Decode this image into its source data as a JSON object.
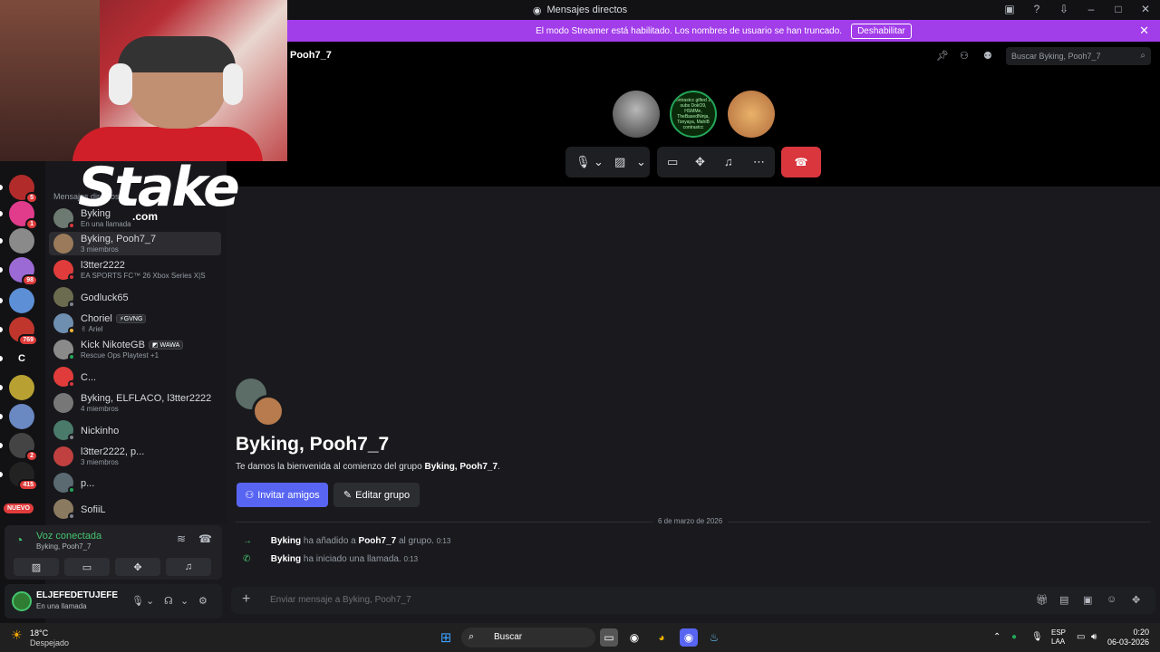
{
  "window": {
    "title": "Mensajes directos"
  },
  "banner": {
    "text": "El modo Streamer está habilitado. Los nombres de usuario se han truncado.",
    "button": "Deshabilitar"
  },
  "servers": [
    {
      "letter": "",
      "badge": "5",
      "color": "#b22b2b"
    },
    {
      "letter": "",
      "badge": "1",
      "color": "#e13b8c"
    },
    {
      "letter": "",
      "badge": "",
      "color": "#8a8a8a"
    },
    {
      "letter": "",
      "badge": "98",
      "color": "#9c6ad4"
    },
    {
      "letter": "",
      "badge": "",
      "color": "#5c8fd6"
    },
    {
      "letter": "",
      "badge": "769",
      "color": "#c0362c"
    },
    {
      "letter": "C",
      "badge": "",
      "color": "#121214"
    },
    {
      "letter": "",
      "badge": "",
      "color": "#b8a132"
    },
    {
      "letter": "",
      "badge": "",
      "color": "#6a88c2"
    },
    {
      "letter": "",
      "badge": "2",
      "color": "#444"
    },
    {
      "letter": "",
      "badge": "415",
      "color": "#222"
    }
  ],
  "nuevo": "NUEVO",
  "sidebar": {
    "section": "Mensajes directos",
    "dms": [
      {
        "name": "Byking",
        "sub": "En una llamada",
        "av": "#6d7a72",
        "status": "#d9363e"
      },
      {
        "name": "Byking, Pooh7_7",
        "sub": "3 miembros",
        "av": "#9a7a5a",
        "status": "",
        "active": true
      },
      {
        "name": "l3tter2222",
        "sub": "EA SPORTS FC™ 26 Xbox Series X|S",
        "av": "#e03c3c",
        "status": "#d9363e"
      },
      {
        "name": "Godluck65",
        "sub": "",
        "av": "#6b6b50",
        "status": "#80848e"
      },
      {
        "name": "Choriel",
        "tag": "⚡GVNG",
        "sub": "✌ Ariel",
        "av": "#6f8fb0",
        "status": "#f0b232"
      },
      {
        "name": "Kick NikoteGB",
        "tag": "◩ WAWA",
        "sub": "Rescue Ops Playtest +1",
        "av": "#8a8a8a",
        "status": "#23a559"
      },
      {
        "name": "C...",
        "sub": "",
        "av": "#e03c3c",
        "status": "#d9363e"
      },
      {
        "name": "Byking, ELFLACO, l3tter2222",
        "sub": "4 miembros",
        "av": "#777",
        "status": ""
      },
      {
        "name": "Nickinho",
        "sub": "",
        "av": "#4a7a6a",
        "status": "#80848e"
      },
      {
        "name": "l3tter2222, p...",
        "sub": "3 miembros",
        "av": "#c04040",
        "status": ""
      },
      {
        "name": "p...",
        "sub": "",
        "av": "#5a6a70",
        "status": "#23a559"
      },
      {
        "name": "SofiiL",
        "sub": "",
        "av": "#8a7a60",
        "status": "#80848e"
      }
    ]
  },
  "voice": {
    "status": "Voz conectada",
    "channel": "Byking, Pooh7_7"
  },
  "user": {
    "name": "ELJEFEDETUJEFE",
    "status": "En una llamada"
  },
  "header": {
    "name": "Pooh7_7",
    "search_placeholder": "Buscar Byking, Pooh7_7"
  },
  "call": {
    "avatar2_text": "contrastcc gifted 10 subs DokO9, HSMMe, TheBasedNinja, Tonyaya, MahiB contrastcc"
  },
  "group": {
    "title": "Byking, Pooh7_7",
    "welcome_prefix": "Te damos la bienvenida al comienzo del grupo",
    "welcome_name": "Byking, Pooh7_7",
    "welcome_suffix": ".",
    "invite": "Invitar amigos",
    "edit": "Editar grupo"
  },
  "date_divider": "6 de marzo de 2026",
  "messages": [
    {
      "user": "Byking",
      "text1": "ha añadido a",
      "target": "Pooh7_7",
      "text2": "al grupo.",
      "time": "0:13"
    },
    {
      "user": "Byking",
      "text1": "ha iniciado una llamada.",
      "target": "",
      "text2": "",
      "time": "0:13"
    }
  ],
  "composer": {
    "placeholder": "Enviar mensaje a Byking, Pooh7_7"
  },
  "stake": {
    "word": "Stake",
    "tld": ".com"
  },
  "taskbar": {
    "weather_temp": "18°C",
    "weather_desc": "Despejado",
    "search": "Buscar",
    "lang1": "ESP",
    "lang2": "LAA",
    "time": "0:20",
    "date": "06-03-2026"
  },
  "colors": {
    "accent": "#5865f2",
    "banner": "#a23dea",
    "hangup": "#d9363e",
    "online": "#23a559"
  }
}
